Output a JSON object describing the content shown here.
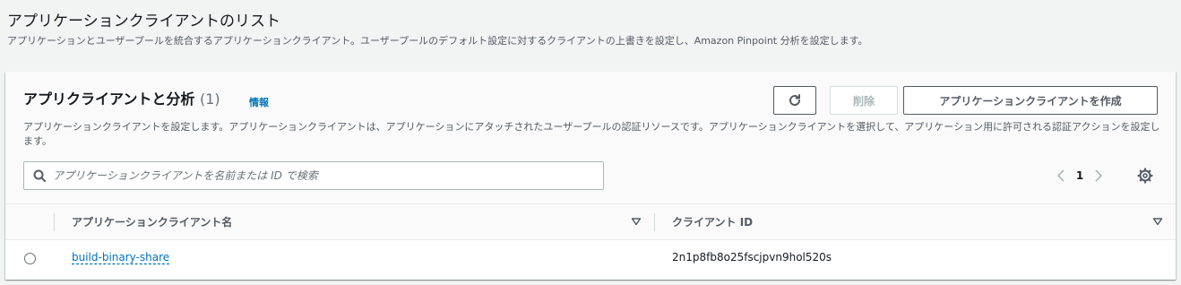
{
  "page": {
    "title": "アプリケーションクライアントのリスト",
    "description": "アプリケーションとユーザープールを統合するアプリケーションクライアント。ユーザープールのデフォルト設定に対するクライアントの上書きを設定し、Amazon Pinpoint 分析を設定します。"
  },
  "card": {
    "title": "アプリクライアントと分析",
    "count": "(1)",
    "info_link": "情報",
    "description": "アプリケーションクライアントを設定します。アプリケーションクライアントは、アプリケーションにアタッチされたユーザープールの認証リソースです。アプリケーションクライアントを選択して、アプリケーション用に許可される認証アクションを設定します。",
    "buttons": {
      "delete": "削除",
      "create": "アプリケーションクライアントを作成"
    },
    "search": {
      "placeholder": "アプリケーションクライアントを名前または ID で検索",
      "value": ""
    },
    "pagination": {
      "current_page": "1"
    },
    "table": {
      "columns": [
        "アプリケーションクライアント名",
        "クライアント ID"
      ],
      "rows": [
        {
          "name": "build-binary-share",
          "client_id": "2n1p8fb8o25fscjpvn9hol520s"
        }
      ]
    }
  },
  "colors": {
    "link": "#0073bb",
    "background": "#f2f3f3",
    "text": "#16191f",
    "muted": "#545b64"
  },
  "icons": [
    "refresh-icon",
    "search-icon",
    "chevron-left-icon",
    "chevron-right-icon",
    "settings-gear-icon",
    "sort-caret-icon"
  ]
}
